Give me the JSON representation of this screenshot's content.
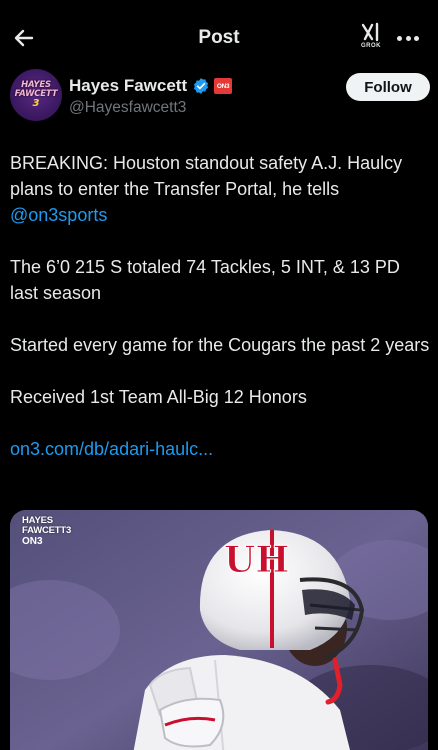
{
  "topbar": {
    "title": "Post",
    "back_icon": "arrow-left-icon",
    "grok_label": "GROK",
    "more_icon": "more-horizontal-icon"
  },
  "author": {
    "name": "Hayes Fawcett",
    "handle": "@Hayesfawcett3",
    "avatar_lines": [
      "HAYES",
      "FAWCETT",
      "3"
    ],
    "org_badge": "ON3",
    "verified_color": "#1d9bf0",
    "follow_label": "Follow"
  },
  "post": {
    "p1_text": "BREAKING: Houston standout safety A.J. Haulcy plans to enter the Transfer Portal, he tells ",
    "p1_mention": "@on3sports",
    "p2": "The 6’0 215 S totaled 74 Tackles, 5 INT, & 13 PD last season",
    "p3": "Started every game for the Cougars the past 2 years",
    "p4": "Received 1st Team All-Big 12 Honors",
    "link": "on3.com/db/adari-haulc..."
  },
  "media": {
    "watermark_lines": [
      "HAYES",
      "FAWCETT3"
    ],
    "watermark_logo": "ON3",
    "helmet_logo": "UH",
    "description_colors": {
      "helmet": "#f2f2f2",
      "logo": "#c8102e",
      "background": "#4a4270"
    }
  },
  "colors": {
    "background": "#000000",
    "text": "#e7e9ea",
    "secondary_text": "#71767b",
    "link": "#1d9bf0",
    "follow_bg": "#eff3f4"
  }
}
